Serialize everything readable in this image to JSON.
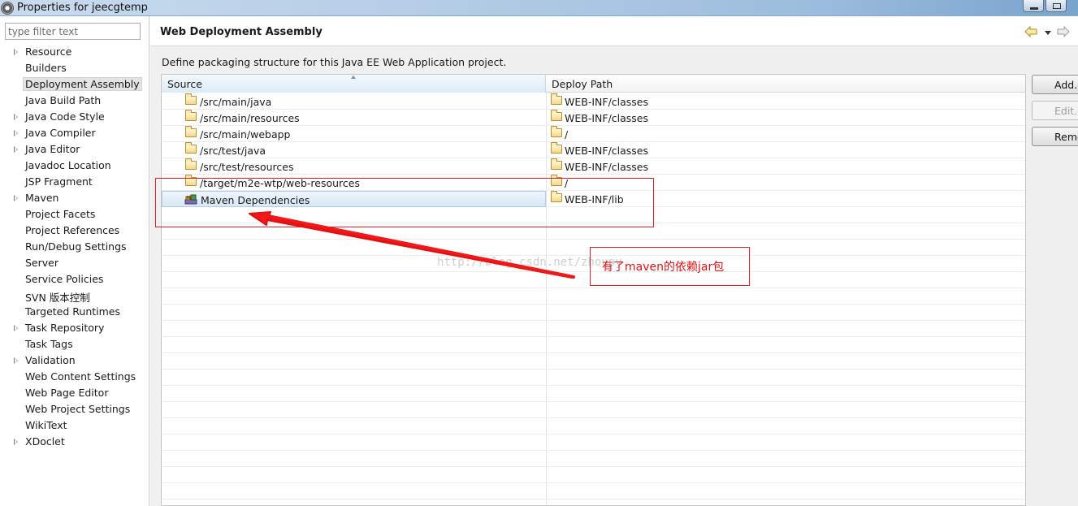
{
  "window": {
    "title": "Properties for jeecgtemp"
  },
  "filter": {
    "placeholder": "type filter text"
  },
  "tree": {
    "items": [
      {
        "label": "Resource",
        "expandable": true
      },
      {
        "label": "Builders",
        "expandable": false
      },
      {
        "label": "Deployment Assembly",
        "expandable": false,
        "selected": true
      },
      {
        "label": "Java Build Path",
        "expandable": false
      },
      {
        "label": "Java Code Style",
        "expandable": true
      },
      {
        "label": "Java Compiler",
        "expandable": true
      },
      {
        "label": "Java Editor",
        "expandable": true
      },
      {
        "label": "Javadoc Location",
        "expandable": false
      },
      {
        "label": "JSP Fragment",
        "expandable": false
      },
      {
        "label": "Maven",
        "expandable": true
      },
      {
        "label": "Project Facets",
        "expandable": false
      },
      {
        "label": "Project References",
        "expandable": false
      },
      {
        "label": "Run/Debug Settings",
        "expandable": false
      },
      {
        "label": "Server",
        "expandable": false
      },
      {
        "label": "Service Policies",
        "expandable": false
      },
      {
        "label": "SVN 版本控制",
        "expandable": false
      },
      {
        "label": "Targeted Runtimes",
        "expandable": false
      },
      {
        "label": "Task Repository",
        "expandable": true
      },
      {
        "label": "Task Tags",
        "expandable": false
      },
      {
        "label": "Validation",
        "expandable": true
      },
      {
        "label": "Web Content Settings",
        "expandable": false
      },
      {
        "label": "Web Page Editor",
        "expandable": false
      },
      {
        "label": "Web Project Settings",
        "expandable": false
      },
      {
        "label": "WikiText",
        "expandable": false
      },
      {
        "label": "XDoclet",
        "expandable": true
      }
    ]
  },
  "page": {
    "title": "Web Deployment Assembly",
    "description": "Define packaging structure for this Java EE Web Application project."
  },
  "table": {
    "columns": {
      "source": "Source",
      "deploy_path": "Deploy Path"
    },
    "rows": [
      {
        "source": "/src/main/java",
        "deploy": "WEB-INF/classes",
        "icon": "folder-icon"
      },
      {
        "source": "/src/main/resources",
        "deploy": "WEB-INF/classes",
        "icon": "folder-icon"
      },
      {
        "source": "/src/main/webapp",
        "deploy": "/",
        "icon": "folder-icon"
      },
      {
        "source": "/src/test/java",
        "deploy": "WEB-INF/classes",
        "icon": "folder-icon"
      },
      {
        "source": "/src/test/resources",
        "deploy": "WEB-INF/classes",
        "icon": "folder-icon"
      },
      {
        "source": "/target/m2e-wtp/web-resources",
        "deploy": "/",
        "icon": "folder-icon"
      },
      {
        "source": "Maven Dependencies",
        "deploy": "WEB-INF/lib",
        "icon": "library-icon",
        "selected": true
      }
    ]
  },
  "buttons": {
    "add": "Add...",
    "edit": "Edit...",
    "remove": "Remove"
  },
  "annotation": {
    "label": "有了maven的依赖jar包",
    "watermark": "http://blog.csdn.net/zhoupy",
    "color": "#e02020"
  }
}
